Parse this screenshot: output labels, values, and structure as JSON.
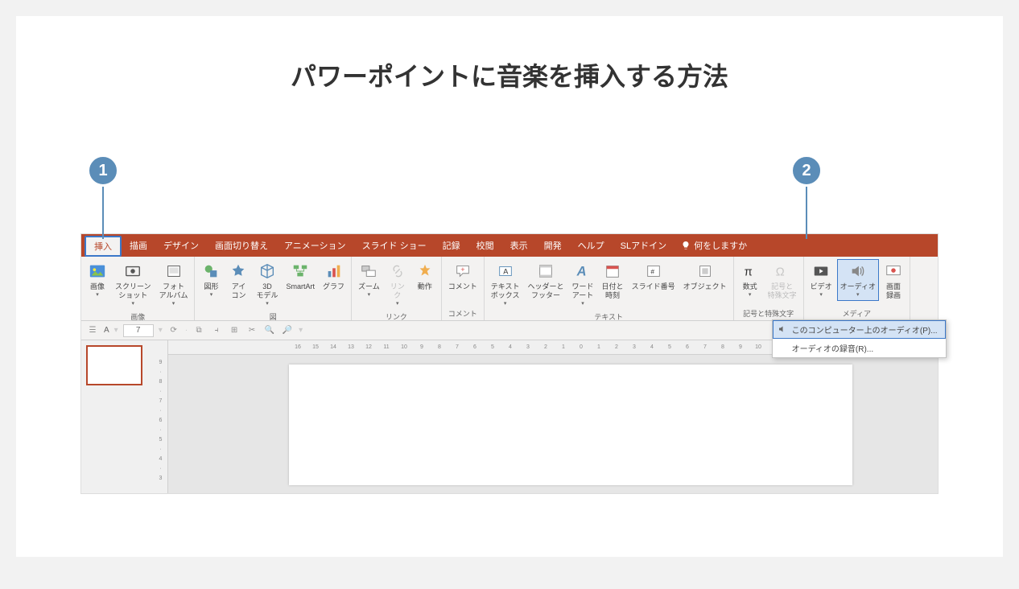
{
  "page_title": "パワーポイントに音楽を挿入する方法",
  "badges": {
    "b1": "1",
    "b2": "2"
  },
  "tabs": {
    "insert": "挿入",
    "draw": "描画",
    "design": "デザイン",
    "transitions": "画面切り替え",
    "animations": "アニメーション",
    "slideshow": "スライド ショー",
    "record": "記録",
    "review": "校閲",
    "view": "表示",
    "developer": "開発",
    "help": "ヘルプ",
    "addin": "SLアドイン",
    "tellme": "何をしますか"
  },
  "groups": {
    "images": "画像",
    "illustrations": "図",
    "links": "リンク",
    "comments": "コメント",
    "text": "テキスト",
    "symbols": "記号と特殊文字",
    "media": "メディア"
  },
  "btn": {
    "pictures": "画像",
    "screenshot": "スクリーン\nショット",
    "photoalbum": "フォト\nアルバム",
    "shapes": "図形",
    "icons": "アイ\nコン",
    "models3d": "3D\nモデル",
    "smartart": "SmartArt",
    "chart": "グラフ",
    "zoom": "ズーム",
    "link": "リン\nク",
    "action": "動作",
    "comment": "コメント",
    "textbox": "テキスト\nボックス",
    "headerfooter": "ヘッダーと\nフッター",
    "wordart": "ワード\nアート",
    "datetime": "日付と\n時刻",
    "slidenumber": "スライド番号",
    "object": "オブジェクト",
    "equation": "数式",
    "symbol": "記号と\n特殊文字",
    "video": "ビデオ",
    "audio": "オーディオ",
    "screenrec": "画面\n録画"
  },
  "audio_menu": {
    "from_pc": "このコンピューター上のオーディオ(P)...",
    "record": "オーディオの録音(R)..."
  },
  "quickbar": {
    "value": "7",
    "font_label": "A"
  },
  "colors": {
    "accent": "#b7472a",
    "badge": "#5b8db8",
    "highlight_border": "#3b78c9"
  }
}
